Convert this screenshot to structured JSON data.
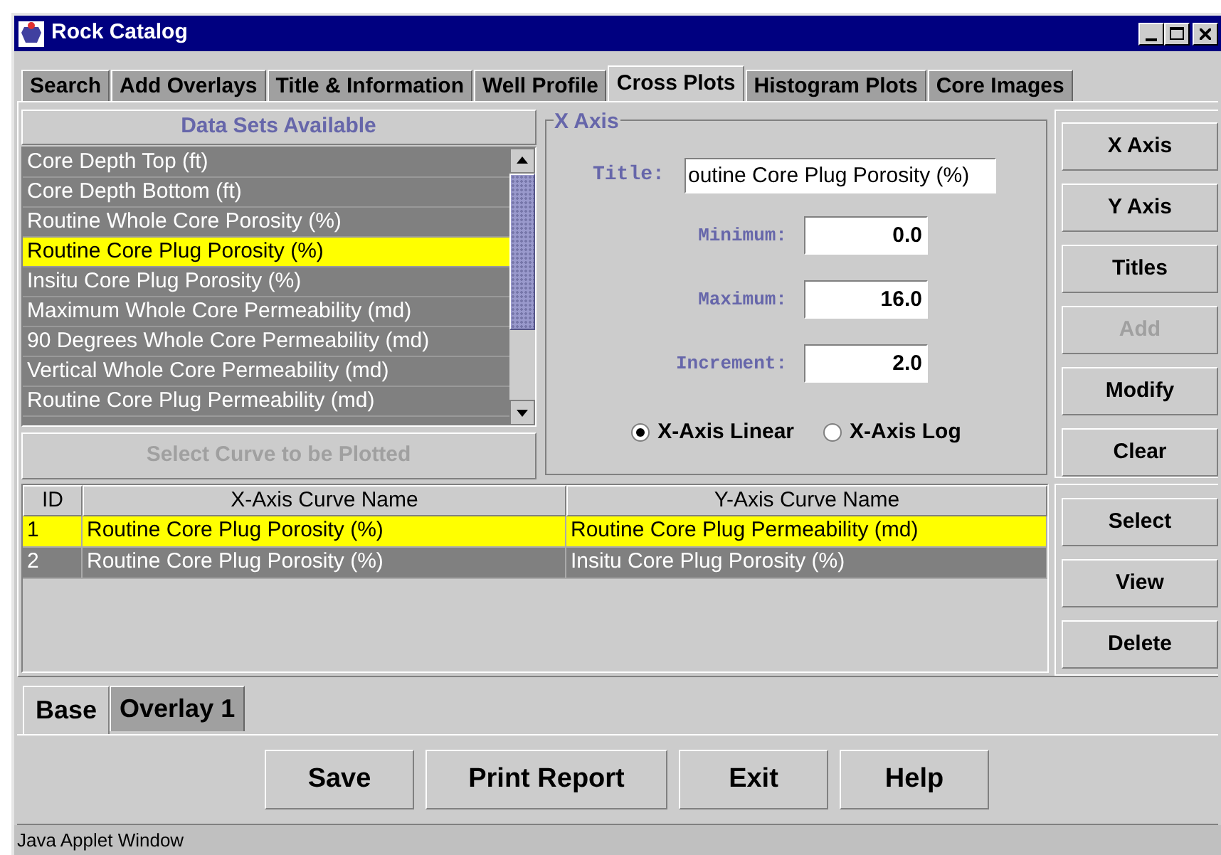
{
  "window": {
    "title": "Rock Catalog"
  },
  "tabs": [
    {
      "label": "Search",
      "selected": false
    },
    {
      "label": "Add Overlays",
      "selected": false
    },
    {
      "label": "Title & Information",
      "selected": false
    },
    {
      "label": "Well Profile",
      "selected": false
    },
    {
      "label": "Cross Plots",
      "selected": true
    },
    {
      "label": "Histogram Plots",
      "selected": false
    },
    {
      "label": "Core Images",
      "selected": false
    }
  ],
  "data_sets": {
    "header": "Data Sets Available",
    "items": [
      {
        "label": "Core Depth Top (ft)",
        "selected": false
      },
      {
        "label": "Core Depth Bottom (ft)",
        "selected": false
      },
      {
        "label": "Routine Whole Core Porosity (%)",
        "selected": false
      },
      {
        "label": "Routine Core Plug Porosity (%)",
        "selected": true
      },
      {
        "label": "Insitu Core Plug Porosity (%)",
        "selected": false
      },
      {
        "label": "Maximum Whole Core Permeability (md)",
        "selected": false
      },
      {
        "label": "90 Degrees Whole Core Permeability (md)",
        "selected": false
      },
      {
        "label": "Vertical Whole Core Permeability (md)",
        "selected": false
      },
      {
        "label": "Routine Core Plug Permeability (md)",
        "selected": false
      }
    ],
    "button": {
      "label": "Select Curve to be Plotted",
      "disabled": true
    }
  },
  "axis_group": {
    "title": "X Axis",
    "title_field": {
      "label": "Title:",
      "value": "outine Core Plug Porosity (%)"
    },
    "fields": [
      {
        "label": "Minimum:",
        "value": "0.0"
      },
      {
        "label": "Maximum:",
        "value": "16.0"
      },
      {
        "label": "Increment:",
        "value": "2.0"
      }
    ],
    "scale_options": [
      {
        "label": "X-Axis Linear",
        "selected": true
      },
      {
        "label": "X-Axis Log",
        "selected": false
      }
    ]
  },
  "axis_buttons": [
    {
      "label": "X Axis",
      "disabled": false
    },
    {
      "label": "Y Axis",
      "disabled": false
    },
    {
      "label": "Titles",
      "disabled": false
    },
    {
      "label": "Add",
      "disabled": true
    },
    {
      "label": "Modify",
      "disabled": false
    },
    {
      "label": "Clear",
      "disabled": false
    }
  ],
  "table": {
    "columns": [
      "ID",
      "X-Axis Curve Name",
      "Y-Axis Curve Name"
    ],
    "rows": [
      {
        "cells": [
          "1",
          "Routine Core Plug Porosity (%)",
          "Routine Core Plug Permeability (md)"
        ],
        "selected": true
      },
      {
        "cells": [
          "2",
          "Routine Core Plug Porosity (%)",
          "Insitu Core Plug Porosity (%)"
        ],
        "selected": false
      }
    ]
  },
  "table_buttons": [
    "Select",
    "View",
    "Delete"
  ],
  "plot_tabs": [
    {
      "label": "Base",
      "selected": true
    },
    {
      "label": "Overlay 1",
      "selected": false
    }
  ],
  "actions": [
    "Save",
    "Print Report",
    "Exit",
    "Help"
  ],
  "status_bar": "Java Applet Window"
}
